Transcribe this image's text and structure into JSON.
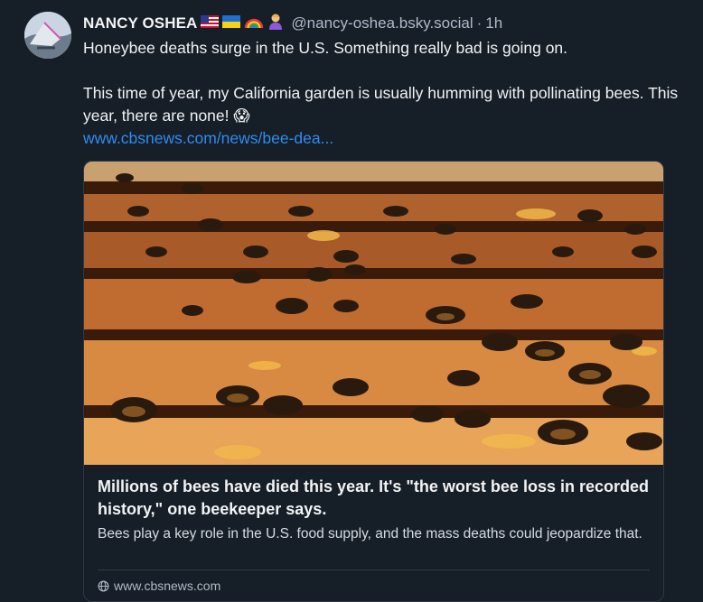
{
  "post": {
    "author_name": "NANCY OSHEA",
    "author_emojis": [
      "flag-us-icon",
      "flag-ukraine-icon",
      "rainbow-icon",
      "person-emoji-icon"
    ],
    "handle": "@nancy-oshea.bsky.social",
    "separator": "·",
    "time": "1h",
    "text_line1": "Honeybee deaths surge in the U.S.  Something really bad is going on.",
    "text_line2": "This time of year, my California garden is usually humming with pollinating bees. This year, there are none! 😱",
    "link_text": "www.cbsnews.com/news/bee-dea..."
  },
  "card": {
    "title": "Millions of bees have died this year. It's \"the worst bee loss in recorded history,\" one beekeeper says.",
    "description": "Bees play a key role in the U.S. food supply, and the mass deaths could jeopardize that.",
    "domain": "www.cbsnews.com"
  },
  "colors": {
    "background": "#161e27",
    "link": "#2f8cf0",
    "muted": "#aebbc9",
    "border": "#2e3a47"
  }
}
